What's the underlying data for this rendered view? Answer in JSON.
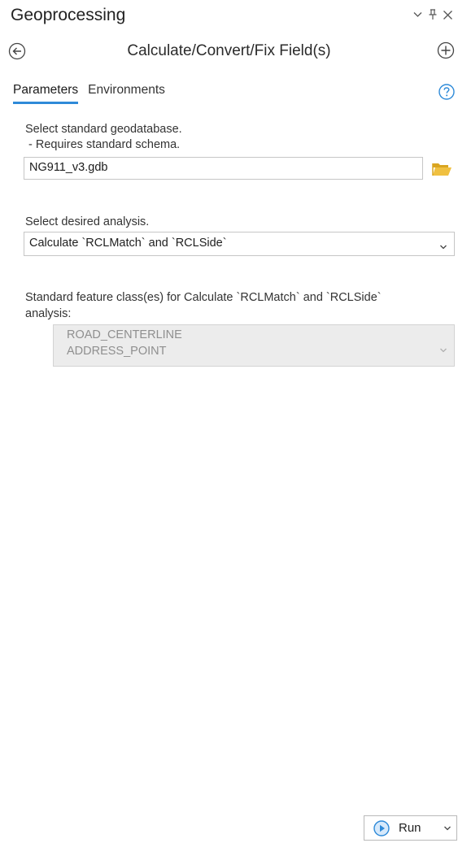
{
  "pane": {
    "title": "Geoprocessing"
  },
  "tool": {
    "title": "Calculate/Convert/Fix Field(s)"
  },
  "tabs": [
    {
      "label": "Parameters",
      "active": true
    },
    {
      "label": "Environments",
      "active": false
    }
  ],
  "params": {
    "gdb_label_line1": "Select standard geodatabase.",
    "gdb_label_line2": " - Requires standard schema.",
    "gdb_value": "NG911_v3.gdb",
    "analysis_label": "Select desired analysis.",
    "analysis_value": "Calculate `RCLMatch` and `RCLSide`",
    "fc_label_line1": "Standard feature class(es) for Calculate `RCLMatch` and `RCLSide`",
    "fc_label_line2": "analysis:",
    "fc_values": [
      "ROAD_CENTERLINE",
      "ADDRESS_POINT"
    ]
  },
  "footer": {
    "run_label": "Run"
  },
  "icons": {
    "dropdown_menu": "chevron-down-icon",
    "pin": "pin-icon",
    "close": "close-icon",
    "back": "back-arrow-icon",
    "add": "plus-circle-icon",
    "help": "help-icon",
    "browse": "folder-icon",
    "run": "play-icon"
  },
  "colors": {
    "accent": "#2e8ad8",
    "folder": "#e8b838",
    "disabled_bg": "#ececec",
    "disabled_text": "#8f8f8f"
  }
}
